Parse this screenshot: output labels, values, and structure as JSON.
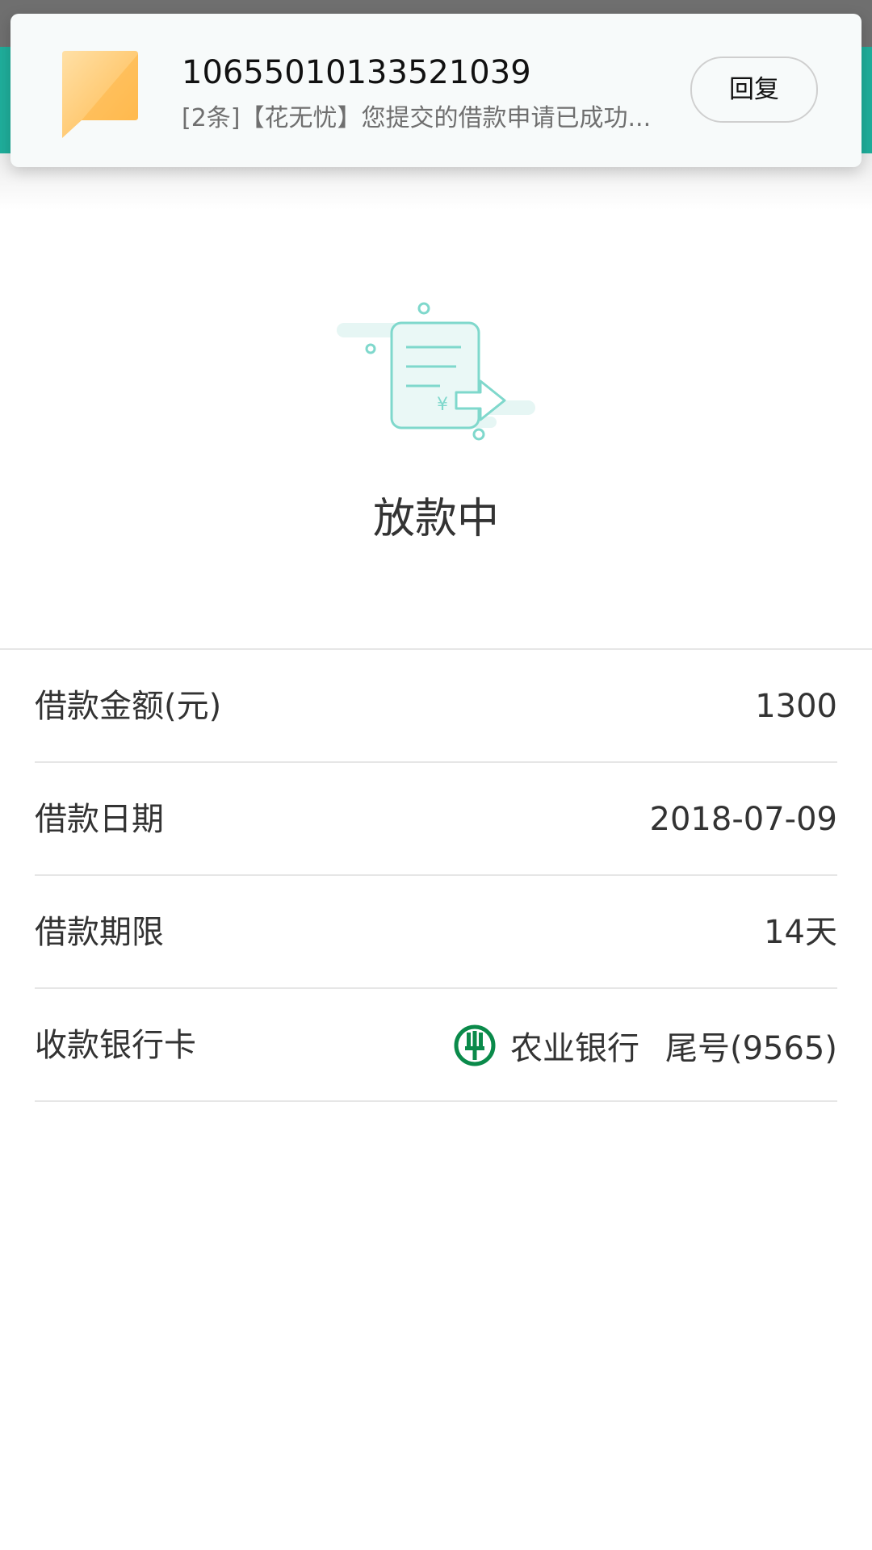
{
  "notification": {
    "sender": "10655010133521039",
    "preview": "[2条]【花无忧】您提交的借款申请已成功...",
    "reply_label": "回复",
    "icon": "message-icon"
  },
  "header": {
    "back_icon": "back-arrow-icon",
    "color": "#1fae9b"
  },
  "status": {
    "title": "放款中",
    "icon": "loan-disbursing-icon"
  },
  "details": {
    "amount_label": "借款金额(元)",
    "amount_value": "1300",
    "date_label": "借款日期",
    "date_value": "2018-07-09",
    "term_label": "借款期限",
    "term_value": "14天",
    "card_label": "收款银行卡",
    "bank_name": "农业银行",
    "bank_tail": "尾号(9565)",
    "bank_icon": "abc-bank-logo-icon"
  },
  "colors": {
    "accent": "#1fae9b",
    "illustration": "#7fd8cc",
    "bank_logo": "#0a8a4a"
  }
}
